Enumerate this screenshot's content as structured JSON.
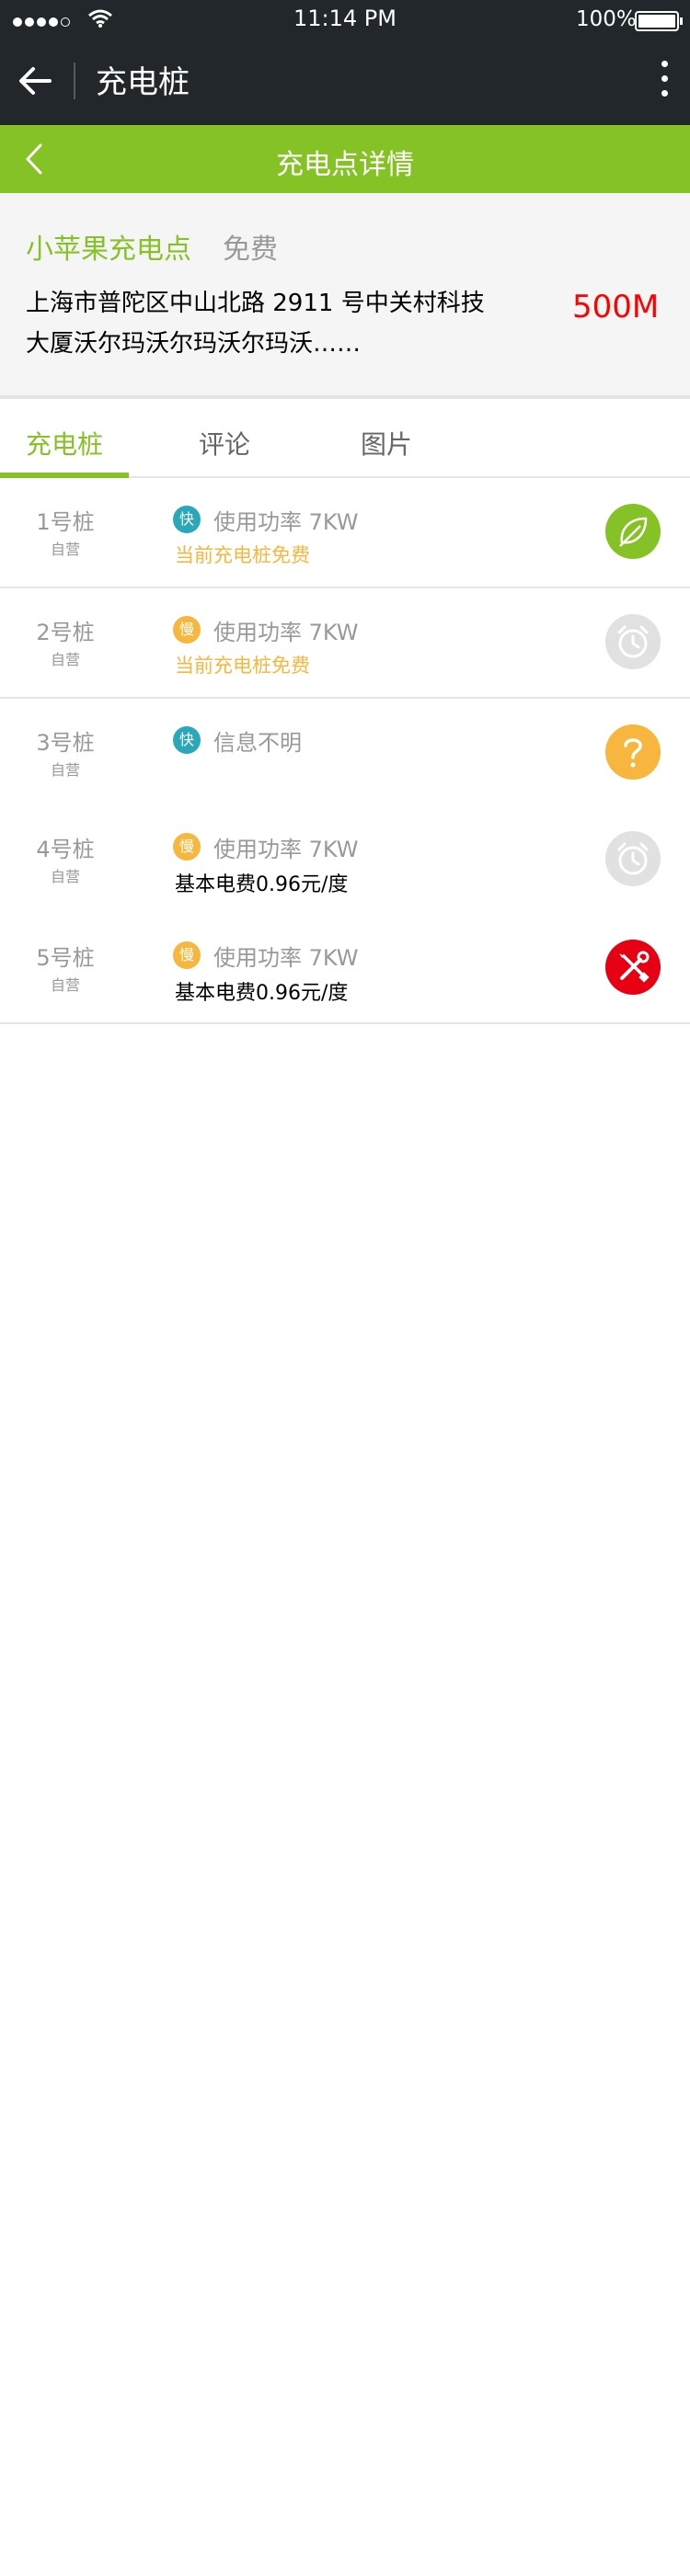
{
  "status_bar": {
    "time": "11:14 PM",
    "battery": "100%",
    "signal_icon": "signal-dots-icon",
    "wifi_icon": "wifi-icon",
    "battery_icon": "battery-icon"
  },
  "nav": {
    "title": "充电桩",
    "back_icon": "arrow-left-icon",
    "more_icon": "more-vertical-icon"
  },
  "subbar": {
    "title": "充电点详情",
    "back_icon": "chevron-left-icon"
  },
  "station": {
    "name": "小苹果充电点",
    "price": "免费",
    "address": "上海市普陀区中山北路 2911 号中关村科技大厦沃尔玛沃尔玛沃尔玛沃……",
    "distance": "500M"
  },
  "tabs": [
    {
      "label": "充电桩",
      "active": true
    },
    {
      "label": "评论",
      "active": false
    },
    {
      "label": "图片",
      "active": false
    }
  ],
  "piles": [
    {
      "number": "1号桩",
      "operator": "自营",
      "badge": "快",
      "badge_type": "fast",
      "power": "使用功率 7KW",
      "line2": "当前充电桩免费",
      "line2_type": "free",
      "status_icon": "leaf-icon",
      "status_color": "#85c226"
    },
    {
      "number": "2号桩",
      "operator": "自营",
      "badge": "慢",
      "badge_type": "slow",
      "power": "使用功率 7KW",
      "line2": "当前充电桩免费",
      "line2_type": "free",
      "status_icon": "alarm-clock-icon",
      "status_color": "#e1e1e1"
    },
    {
      "number": "3号桩",
      "operator": "自营",
      "badge": "快",
      "badge_type": "fast",
      "power": "信息不明",
      "line2": "",
      "line2_type": "none",
      "status_icon": "question-icon",
      "status_color": "#f7b63e"
    },
    {
      "number": "4号桩",
      "operator": "自营",
      "badge": "慢",
      "badge_type": "slow",
      "power": "使用功率 7KW",
      "line2": "基本电费0.96元/度",
      "line2_type": "fee",
      "status_icon": "alarm-clock-icon",
      "status_color": "#e1e1e1"
    },
    {
      "number": "5号桩",
      "operator": "自营",
      "badge": "慢",
      "badge_type": "slow",
      "power": "使用功率 7KW",
      "line2": "基本电费0.96元/度",
      "line2_type": "fee",
      "status_icon": "wrench-screwdriver-icon",
      "status_color": "#e60012"
    }
  ]
}
